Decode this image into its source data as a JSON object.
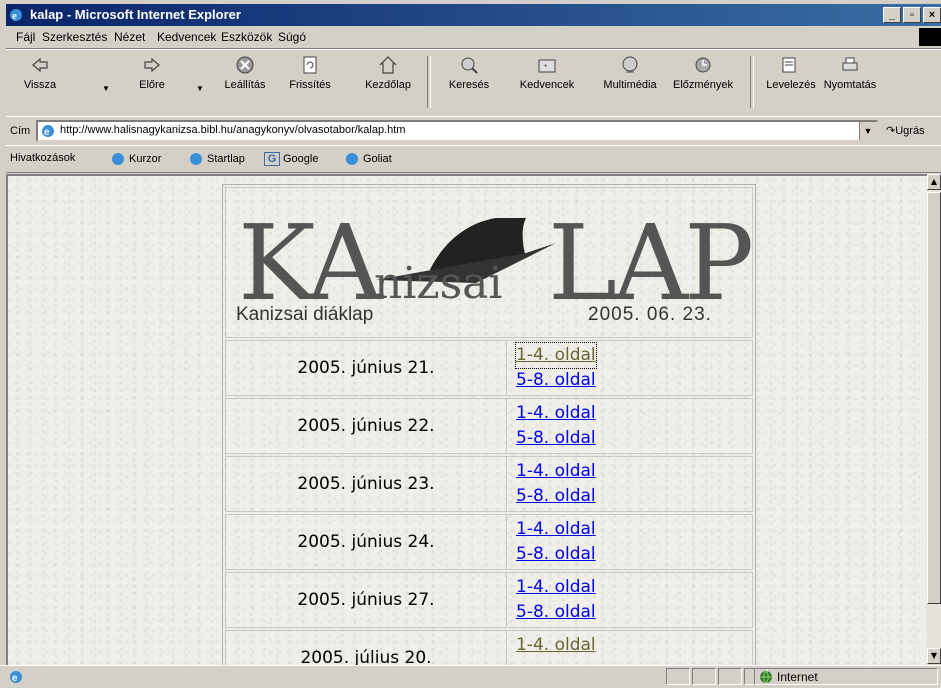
{
  "window": {
    "title": "kalap - Microsoft Internet Explorer"
  },
  "menu": [
    "Fájl",
    "Szerkesztés",
    "Nézet",
    "Kedvencek",
    "Eszközök",
    "Súgó"
  ],
  "toolbar": {
    "back": "Vissza",
    "forward": "Előre",
    "stop": "Leállítás",
    "refresh": "Frissítés",
    "home": "Kezdőlap",
    "search": "Keresés",
    "favorites": "Kedvencek",
    "media": "Multimédia",
    "history": "Előzmények",
    "mail": "Levelezés",
    "print": "Nyomtatás"
  },
  "address": {
    "label": "Cím",
    "url": "http://www.halisnagykanizsa.bibl.hu/anagykonyv/olvasotabor/kalap.htm",
    "go": "Ugrás"
  },
  "links": {
    "label": "Hivatkozások",
    "items": [
      "Kurzor",
      "Startlap",
      "Google",
      "Goliat"
    ]
  },
  "banner": {
    "title_left": "KA",
    "title_mid": "nizsai",
    "title_right": "LAP",
    "subtitle": "Kanizsai diáklap",
    "date": "2005. 06. 23."
  },
  "issues": [
    {
      "date": "2005. június 21.",
      "link1": "1-4. oldal",
      "link2": "5-8. oldal"
    },
    {
      "date": "2005. június 22.",
      "link1": "1-4. oldal",
      "link2": "5-8. oldal"
    },
    {
      "date": "2005. június 23.",
      "link1": "1-4. oldal",
      "link2": "5-8. oldal"
    },
    {
      "date": "2005. június 24.",
      "link1": "1-4. oldal",
      "link2": "5-8. oldal"
    },
    {
      "date": "2005. június 27.",
      "link1": "1-4. oldal",
      "link2": "5-8. oldal"
    },
    {
      "date": "2005. július 20.",
      "link1": "1-4. oldal"
    }
  ],
  "status": {
    "zone": "Internet"
  }
}
